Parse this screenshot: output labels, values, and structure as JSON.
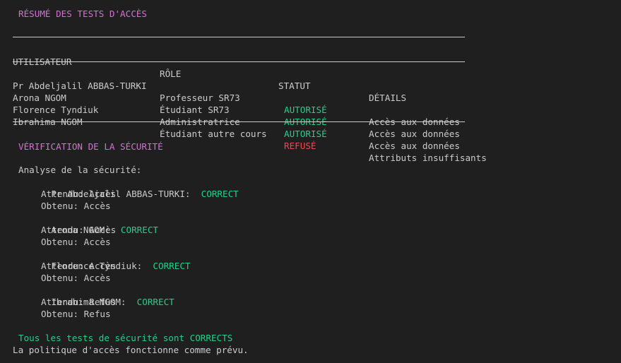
{
  "summary_title": "RÉSUMÉ DES TESTS D'ACCÈS",
  "table": {
    "headers": [
      "UTILISATEUR",
      "RÔLE",
      "STATUT",
      "DÉTAILS"
    ],
    "rows": [
      {
        "user": "Pr Abdeljalil ABBAS-TURKI",
        "role": "Professeur SR73",
        "status": "AUTORISÉ",
        "status_kind": "ok",
        "details": "Accès aux données"
      },
      {
        "user": "Arona NGOM",
        "role": "Étudiant SR73",
        "status": "AUTORISÉ",
        "status_kind": "ok",
        "details": "Accès aux données"
      },
      {
        "user": "Florence Tyndiuk",
        "role": "Administratrice",
        "status": "AUTORISÉ",
        "status_kind": "ok",
        "details": "Accès aux données"
      },
      {
        "user": "Ibrahima NGOM",
        "role": "Étudiant autre cours",
        "status": "REFUSÉ",
        "status_kind": "denied",
        "details": "Attributs insuffisants"
      }
    ]
  },
  "security_title": "VÉRIFICATION DE LA SÉCURITÉ",
  "analysis_heading": "Analyse de la sécurité:",
  "checks": [
    {
      "name": "Pr Abdeljalil ABBAS-TURKI:",
      "result": "CORRECT",
      "expected": "Attendu: Accès",
      "obtained": "Obtenu: Accès"
    },
    {
      "name": "Arona NGOM:",
      "result": "CORRECT",
      "expected": "Attendu: Accès",
      "obtained": "Obtenu: Accès"
    },
    {
      "name": "Florence Tyndiuk:",
      "result": "CORRECT",
      "expected": "Attendu: Accès",
      "obtained": "Obtenu: Accès"
    },
    {
      "name": "Ibrahima NGOM:",
      "result": "CORRECT",
      "expected": "Attendu: Refus",
      "obtained": "Obtenu: Refus"
    }
  ],
  "final_status": "Tous les tests de sécurité sont CORRECTS",
  "final_note": "La politique d'accès fonctionne comme prévu.",
  "colors": {
    "background": "#1f1f1f",
    "text": "#cccccc",
    "heading": "#d670d6",
    "success": "#23d18b",
    "error": "#f14c4c"
  }
}
